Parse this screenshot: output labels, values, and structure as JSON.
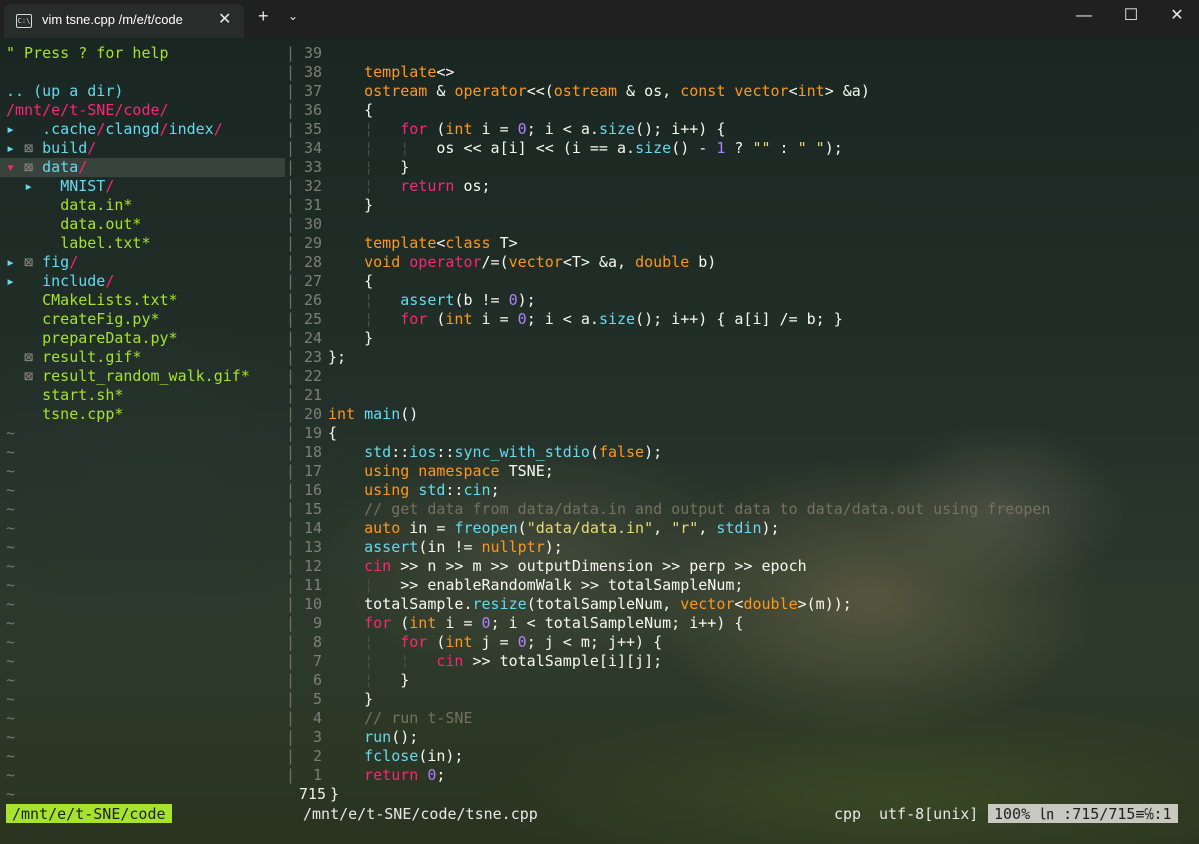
{
  "window": {
    "tab_title": "vim tsne.cpp  /m/e/t/code",
    "tab_icon": "terminal-icon",
    "close_tab": "✕",
    "new_tab": "+",
    "dropdown": "⌄",
    "minimize": "—",
    "maximize": "☐",
    "close": "✕"
  },
  "nerdtree": {
    "help": "\" Press ? for help",
    "up_dir": ".. (up a dir)",
    "root": "/mnt/e/t-SNE/code/",
    "items": [
      {
        "arrow": "▸",
        "box": "",
        "parts": [
          ".cache",
          "/",
          "clangd",
          "/",
          "index",
          "/"
        ]
      },
      {
        "arrow": "▸",
        "box": "⊠",
        "parts": [
          "build",
          "/"
        ]
      },
      {
        "arrow": "▾",
        "box": "⊠",
        "parts": [
          "data",
          "/"
        ]
      },
      {
        "arrow": "▸",
        "box": "",
        "parts": [
          "MNIST",
          "/"
        ]
      },
      {
        "arrow": "",
        "box": "",
        "parts": [
          "data.in*"
        ]
      },
      {
        "arrow": "",
        "box": "",
        "parts": [
          "data.out*"
        ]
      },
      {
        "arrow": "",
        "box": "",
        "parts": [
          "label.txt*"
        ]
      },
      {
        "arrow": "▸",
        "box": "⊠",
        "parts": [
          "fig",
          "/"
        ]
      },
      {
        "arrow": "▸",
        "box": "",
        "parts": [
          "include",
          "/"
        ]
      },
      {
        "arrow": "",
        "box": "",
        "parts": [
          "CMakeLists.txt*"
        ]
      },
      {
        "arrow": "",
        "box": "",
        "parts": [
          "createFig.py*"
        ]
      },
      {
        "arrow": "",
        "box": "",
        "parts": [
          "prepareData.py*"
        ]
      },
      {
        "arrow": "",
        "box": "⊠",
        "parts": [
          "result.gif*"
        ]
      },
      {
        "arrow": "",
        "box": "⊠",
        "parts": [
          "result_random_walk.gif*"
        ]
      },
      {
        "arrow": "",
        "box": "",
        "parts": [
          "start.sh*"
        ]
      },
      {
        "arrow": "",
        "box": "",
        "parts": [
          "tsne.cpp*"
        ]
      }
    ],
    "tilde": "~",
    "tilde_count": 20
  },
  "editor": {
    "current_line": "715",
    "lines": [
      {
        "n": "39",
        "t": []
      },
      {
        "n": "38",
        "t": [
          [
            "pl",
            "    "
          ],
          [
            "ty",
            "template"
          ],
          [
            "pl",
            "<>"
          ]
        ]
      },
      {
        "n": "37",
        "t": [
          [
            "pl",
            "    "
          ],
          [
            "ty",
            "ostream"
          ],
          [
            "pl",
            " & "
          ],
          [
            "ty",
            "operator"
          ],
          [
            "pl",
            "<<("
          ],
          [
            "ty",
            "ostream"
          ],
          [
            "pl",
            " & os, "
          ],
          [
            "ty",
            "const vector"
          ],
          [
            "pl",
            "<"
          ],
          [
            "ty",
            "int"
          ],
          [
            "pl",
            "> &a)"
          ]
        ]
      },
      {
        "n": "36",
        "t": [
          [
            "pl",
            "    {"
          ]
        ]
      },
      {
        "n": "35",
        "t": [
          [
            "pl",
            "    "
          ],
          [
            "guide",
            "¦"
          ],
          [
            "pl",
            "   "
          ],
          [
            "kw",
            "for"
          ],
          [
            "pl",
            " ("
          ],
          [
            "ty",
            "int"
          ],
          [
            "pl",
            " i = "
          ],
          [
            "num",
            "0"
          ],
          [
            "pl",
            "; i < a."
          ],
          [
            "fn",
            "size"
          ],
          [
            "pl",
            "(); i++) {"
          ]
        ]
      },
      {
        "n": "34",
        "t": [
          [
            "pl",
            "    "
          ],
          [
            "guide",
            "¦"
          ],
          [
            "pl",
            "   "
          ],
          [
            "guide",
            "¦"
          ],
          [
            "pl",
            "   os << a[i] << (i == a."
          ],
          [
            "fn",
            "size"
          ],
          [
            "pl",
            "() - "
          ],
          [
            "num",
            "1"
          ],
          [
            "pl",
            " ? "
          ],
          [
            "str",
            "\"\""
          ],
          [
            "pl",
            " : "
          ],
          [
            "str",
            "\" \""
          ],
          [
            "pl",
            ");"
          ]
        ]
      },
      {
        "n": "33",
        "t": [
          [
            "pl",
            "    "
          ],
          [
            "guide",
            "¦"
          ],
          [
            "pl",
            "   }"
          ]
        ]
      },
      {
        "n": "32",
        "t": [
          [
            "pl",
            "    "
          ],
          [
            "guide",
            "¦"
          ],
          [
            "pl",
            "   "
          ],
          [
            "kw",
            "return"
          ],
          [
            "pl",
            " os;"
          ]
        ]
      },
      {
        "n": "31",
        "t": [
          [
            "pl",
            "    }"
          ]
        ]
      },
      {
        "n": "30",
        "t": []
      },
      {
        "n": "29",
        "t": [
          [
            "pl",
            "    "
          ],
          [
            "ty",
            "template"
          ],
          [
            "pl",
            "<"
          ],
          [
            "ty",
            "class"
          ],
          [
            "pl",
            " T>"
          ]
        ]
      },
      {
        "n": "28",
        "t": [
          [
            "pl",
            "    "
          ],
          [
            "ty",
            "void"
          ],
          [
            "pl",
            " "
          ],
          [
            "kw",
            "operator"
          ],
          [
            "pl",
            "/=("
          ],
          [
            "ty",
            "vector"
          ],
          [
            "pl",
            "<T> &a, "
          ],
          [
            "ty",
            "double"
          ],
          [
            "pl",
            " b)"
          ]
        ]
      },
      {
        "n": "27",
        "t": [
          [
            "pl",
            "    {"
          ]
        ]
      },
      {
        "n": "26",
        "t": [
          [
            "pl",
            "    "
          ],
          [
            "guide",
            "¦"
          ],
          [
            "pl",
            "   "
          ],
          [
            "fn",
            "assert"
          ],
          [
            "pl",
            "(b != "
          ],
          [
            "num",
            "0"
          ],
          [
            "pl",
            ");"
          ]
        ]
      },
      {
        "n": "25",
        "t": [
          [
            "pl",
            "    "
          ],
          [
            "guide",
            "¦"
          ],
          [
            "pl",
            "   "
          ],
          [
            "kw",
            "for"
          ],
          [
            "pl",
            " ("
          ],
          [
            "ty",
            "int"
          ],
          [
            "pl",
            " i = "
          ],
          [
            "num",
            "0"
          ],
          [
            "pl",
            "; i < a."
          ],
          [
            "fn",
            "size"
          ],
          [
            "pl",
            "(); i++) { a[i] /= b; }"
          ]
        ]
      },
      {
        "n": "24",
        "t": [
          [
            "pl",
            "    }"
          ]
        ]
      },
      {
        "n": "23",
        "t": [
          [
            "pl",
            "};"
          ]
        ]
      },
      {
        "n": "22",
        "t": []
      },
      {
        "n": "21",
        "t": []
      },
      {
        "n": "20",
        "t": [
          [
            "ty",
            "int"
          ],
          [
            "pl",
            " "
          ],
          [
            "fn",
            "main"
          ],
          [
            "pl",
            "()"
          ]
        ]
      },
      {
        "n": "19",
        "t": [
          [
            "pl",
            "{"
          ]
        ]
      },
      {
        "n": "18",
        "t": [
          [
            "pl",
            "    "
          ],
          [
            "fn",
            "std"
          ],
          [
            "pl",
            "::"
          ],
          [
            "fn",
            "ios"
          ],
          [
            "pl",
            "::"
          ],
          [
            "fn",
            "sync_with_stdio"
          ],
          [
            "pl",
            "("
          ],
          [
            "ty",
            "false"
          ],
          [
            "pl",
            ");"
          ]
        ]
      },
      {
        "n": "17",
        "t": [
          [
            "pl",
            "    "
          ],
          [
            "ty",
            "using namespace"
          ],
          [
            "pl",
            " TSNE;"
          ]
        ]
      },
      {
        "n": "16",
        "t": [
          [
            "pl",
            "    "
          ],
          [
            "ty",
            "using"
          ],
          [
            "pl",
            " "
          ],
          [
            "fn",
            "std"
          ],
          [
            "pl",
            "::"
          ],
          [
            "fn",
            "cin"
          ],
          [
            "pl",
            ";"
          ]
        ]
      },
      {
        "n": "15",
        "t": [
          [
            "pl",
            "    "
          ],
          [
            "cm",
            "// get data from data/data.in and output data to data/data.out using freopen"
          ]
        ]
      },
      {
        "n": "14",
        "t": [
          [
            "pl",
            "    "
          ],
          [
            "ty",
            "auto"
          ],
          [
            "pl",
            " in = "
          ],
          [
            "fn",
            "freopen"
          ],
          [
            "pl",
            "("
          ],
          [
            "str",
            "\"data/data.in\""
          ],
          [
            "pl",
            ", "
          ],
          [
            "str",
            "\"r\""
          ],
          [
            "pl",
            ", "
          ],
          [
            "fn",
            "stdin"
          ],
          [
            "pl",
            ");"
          ]
        ]
      },
      {
        "n": "13",
        "t": [
          [
            "pl",
            "    "
          ],
          [
            "fn",
            "assert"
          ],
          [
            "pl",
            "(in != "
          ],
          [
            "ty",
            "nullptr"
          ],
          [
            "pl",
            ");"
          ]
        ]
      },
      {
        "n": "12",
        "t": [
          [
            "pl",
            "    "
          ],
          [
            "kw",
            "cin"
          ],
          [
            "pl",
            " >> n >> m >> outputDimension >> perp >> epoch"
          ]
        ]
      },
      {
        "n": "11",
        "t": [
          [
            "pl",
            "    "
          ],
          [
            "guide",
            "¦"
          ],
          [
            "pl",
            "   >> enableRandomWalk >> totalSampleNum;"
          ]
        ]
      },
      {
        "n": "10",
        "t": [
          [
            "pl",
            "    totalSample."
          ],
          [
            "fn",
            "resize"
          ],
          [
            "pl",
            "(totalSampleNum, "
          ],
          [
            "ty",
            "vector"
          ],
          [
            "pl",
            "<"
          ],
          [
            "ty",
            "double"
          ],
          [
            "pl",
            ">(m));"
          ]
        ]
      },
      {
        "n": "9",
        "t": [
          [
            "pl",
            "    "
          ],
          [
            "kw",
            "for"
          ],
          [
            "pl",
            " ("
          ],
          [
            "ty",
            "int"
          ],
          [
            "pl",
            " i = "
          ],
          [
            "num",
            "0"
          ],
          [
            "pl",
            "; i < totalSampleNum; i++) {"
          ]
        ]
      },
      {
        "n": "8",
        "t": [
          [
            "pl",
            "    "
          ],
          [
            "guide",
            "¦"
          ],
          [
            "pl",
            "   "
          ],
          [
            "kw",
            "for"
          ],
          [
            "pl",
            " ("
          ],
          [
            "ty",
            "int"
          ],
          [
            "pl",
            " j = "
          ],
          [
            "num",
            "0"
          ],
          [
            "pl",
            "; j < m; j++) {"
          ]
        ]
      },
      {
        "n": "7",
        "t": [
          [
            "pl",
            "    "
          ],
          [
            "guide",
            "¦"
          ],
          [
            "pl",
            "   "
          ],
          [
            "guide",
            "¦"
          ],
          [
            "pl",
            "   "
          ],
          [
            "kw",
            "cin"
          ],
          [
            "pl",
            " >> totalSample[i][j];"
          ]
        ]
      },
      {
        "n": "6",
        "t": [
          [
            "pl",
            "    "
          ],
          [
            "guide",
            "¦"
          ],
          [
            "pl",
            "   }"
          ]
        ]
      },
      {
        "n": "5",
        "t": [
          [
            "pl",
            "    }"
          ]
        ]
      },
      {
        "n": "4",
        "t": [
          [
            "pl",
            "    "
          ],
          [
            "cm",
            "// run t-SNE"
          ]
        ]
      },
      {
        "n": "3",
        "t": [
          [
            "pl",
            "    "
          ],
          [
            "fn",
            "run"
          ],
          [
            "pl",
            "();"
          ]
        ]
      },
      {
        "n": "2",
        "t": [
          [
            "pl",
            "    "
          ],
          [
            "fn",
            "fclose"
          ],
          [
            "pl",
            "(in);"
          ]
        ]
      },
      {
        "n": "1",
        "t": [
          [
            "pl",
            "    "
          ],
          [
            "kw",
            "return"
          ],
          [
            "pl",
            " "
          ],
          [
            "num",
            "0"
          ],
          [
            "pl",
            ";"
          ]
        ]
      },
      {
        "n": "715",
        "t": [
          [
            "pl",
            "}"
          ]
        ],
        "cur": true
      }
    ]
  },
  "status": {
    "left_path": "/mnt/e/t-SNE/code",
    "file_path": "/mnt/e/t-SNE/code/tsne.cpp",
    "filetype": "cpp",
    "encoding": "utf-8[unix]",
    "position": "100%  ㏑ :715/715≡℅:1"
  }
}
